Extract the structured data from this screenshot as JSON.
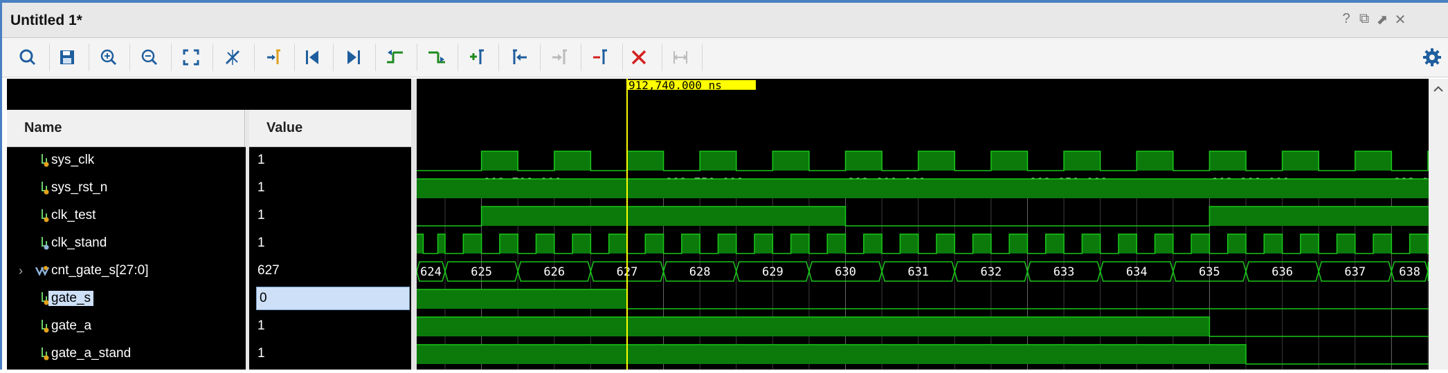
{
  "window": {
    "title": "Untitled 1*",
    "controls": [
      {
        "name": "help-icon",
        "glyph": "?"
      },
      {
        "name": "restore-icon",
        "glyph": "⧉"
      },
      {
        "name": "float-icon",
        "glyph": "⬈"
      },
      {
        "name": "close-window-icon",
        "glyph": "✕"
      }
    ]
  },
  "toolbar": {
    "buttons": [
      {
        "name": "search-icon",
        "enabled": true
      },
      {
        "name": "save-icon",
        "enabled": true
      },
      {
        "name": "zoom-in-icon",
        "enabled": true
      },
      {
        "name": "zoom-out-icon",
        "enabled": true
      },
      {
        "name": "zoom-fit-icon",
        "enabled": true
      },
      {
        "name": "zoom-to-cursor-icon",
        "enabled": true
      },
      {
        "name": "go-to-cursor-icon",
        "enabled": true
      },
      {
        "name": "go-to-time-zero-icon",
        "enabled": true
      },
      {
        "name": "go-to-last-time-icon",
        "enabled": true
      },
      {
        "name": "previous-transition-icon",
        "enabled": true
      },
      {
        "name": "next-transition-icon",
        "enabled": true
      },
      {
        "name": "add-marker-icon",
        "enabled": true
      },
      {
        "name": "previous-marker-icon",
        "enabled": true
      },
      {
        "name": "next-marker-icon",
        "enabled": false
      },
      {
        "name": "delete-marker-icon",
        "enabled": true
      },
      {
        "name": "delete-all-markers-icon",
        "enabled": true
      },
      {
        "name": "swap-cursors-icon",
        "enabled": false
      },
      {
        "name": "settings-icon",
        "enabled": true
      }
    ]
  },
  "columns": {
    "name": "Name",
    "value": "Value"
  },
  "signals": [
    {
      "name": "sys_clk",
      "value": "1",
      "type": "bit"
    },
    {
      "name": "sys_rst_n",
      "value": "1",
      "type": "bit"
    },
    {
      "name": "clk_test",
      "value": "1",
      "type": "bit"
    },
    {
      "name": "clk_stand",
      "value": "1",
      "type": "bit"
    },
    {
      "name": "cnt_gate_s[27:0]",
      "value": "627",
      "type": "bus",
      "expandable": true
    },
    {
      "name": "gate_s",
      "value": "0",
      "type": "bit",
      "selected": true
    },
    {
      "name": "gate_a",
      "value": "1",
      "type": "bit"
    },
    {
      "name": "gate_a_stand",
      "value": "1",
      "type": "bit"
    }
  ],
  "waveform": {
    "cursor_label": "912,740.000 ns",
    "cursor_time": 912740,
    "time_start": 912682.2,
    "time_end": 912960.2,
    "time_ticks": [
      {
        "label": "912,700.000 ns",
        "t": 912700
      },
      {
        "label": "912,750.000 ns",
        "t": 912750
      },
      {
        "label": "912,800.000 ns",
        "t": 912800
      },
      {
        "label": "912,850.000 ns",
        "t": 912850
      },
      {
        "label": "912,900.000 ns",
        "t": 912900
      },
      {
        "label": "912,950.000 ns",
        "t": 912950
      }
    ],
    "colors": {
      "wave": "#19c819",
      "fill": "#0b7a0b",
      "cursor": "#ffff00",
      "grid": "#6a6a6a",
      "text": "#ffffff"
    },
    "traces": {
      "sys_clk": {
        "initial": 0,
        "edges": [
          912700,
          912710,
          912720,
          912730,
          912740,
          912750,
          912760,
          912770,
          912780,
          912790,
          912800,
          912810,
          912820,
          912830,
          912840,
          912850,
          912860,
          912870,
          912880,
          912890,
          912900,
          912910,
          912920,
          912930,
          912940,
          912950,
          912960
        ]
      },
      "sys_rst_n": {
        "initial": 1,
        "edges": []
      },
      "clk_test": {
        "initial": 0,
        "edges": [
          912700,
          912800,
          912900
        ]
      },
      "clk_stand": {
        "initial": 1,
        "edges": [
          912684,
          912688,
          912690,
          912695,
          912700,
          912705,
          912710,
          912715,
          912720,
          912725,
          912730,
          912735,
          912740,
          912745,
          912750,
          912755,
          912760,
          912765,
          912770,
          912775,
          912780,
          912785,
          912790,
          912795,
          912800,
          912805,
          912810,
          912815,
          912820,
          912825,
          912830,
          912835,
          912840,
          912845,
          912850,
          912855,
          912860,
          912865,
          912870,
          912875,
          912880,
          912885,
          912890,
          912895,
          912900,
          912905,
          912910,
          912915,
          912920,
          912925,
          912930,
          912935,
          912940,
          912945,
          912950,
          912955,
          912960
        ]
      },
      "gate_s": {
        "initial": 1,
        "edges": [
          912740
        ]
      },
      "gate_a": {
        "initial": 1,
        "edges": [
          912900
        ]
      },
      "gate_a_stand": {
        "initial": 1,
        "edges": [
          912910
        ]
      }
    },
    "bus": {
      "signal": "cnt_gate_s[27:0]",
      "segments": [
        {
          "label": "624",
          "t0": 912682.2,
          "t1": 912690
        },
        {
          "label": "625",
          "t0": 912690,
          "t1": 912710
        },
        {
          "label": "626",
          "t0": 912710,
          "t1": 912730
        },
        {
          "label": "627",
          "t0": 912730,
          "t1": 912750
        },
        {
          "label": "628",
          "t0": 912750,
          "t1": 912770
        },
        {
          "label": "629",
          "t0": 912770,
          "t1": 912790
        },
        {
          "label": "630",
          "t0": 912790,
          "t1": 912810
        },
        {
          "label": "631",
          "t0": 912810,
          "t1": 912830
        },
        {
          "label": "632",
          "t0": 912830,
          "t1": 912850
        },
        {
          "label": "633",
          "t0": 912850,
          "t1": 912870
        },
        {
          "label": "634",
          "t0": 912870,
          "t1": 912890
        },
        {
          "label": "635",
          "t0": 912890,
          "t1": 912910
        },
        {
          "label": "636",
          "t0": 912910,
          "t1": 912930
        },
        {
          "label": "637",
          "t0": 912930,
          "t1": 912950
        },
        {
          "label": "638",
          "t0": 912950,
          "t1": 912960
        },
        {
          "label": ".",
          "t0": 912960,
          "t1": 912960.2
        }
      ]
    }
  }
}
